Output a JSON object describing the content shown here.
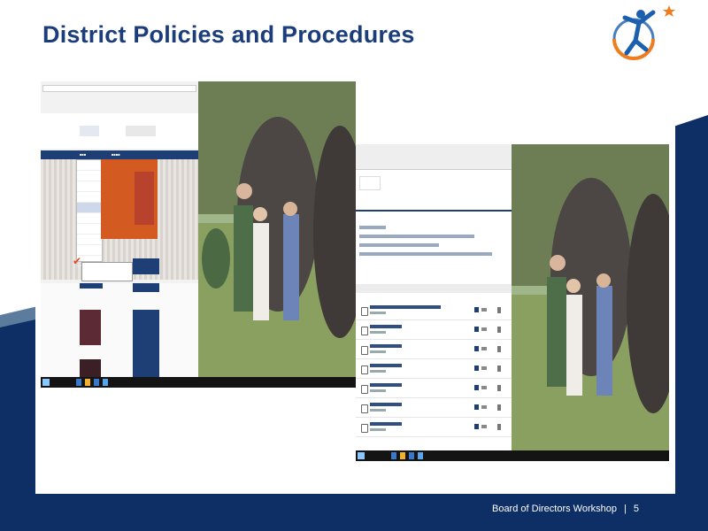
{
  "slide": {
    "title": "District Policies and Procedures",
    "footer_text": "Board of Directors Workshop",
    "footer_separator": "|",
    "page_number": "5"
  },
  "colors": {
    "title": "#1b3d7a",
    "navy_band": "#0d2f66",
    "steel_band": "#5c7c9e",
    "logo_orange": "#f07c20",
    "logo_blue": "#1b5fae",
    "site_nav": "#1d3f75",
    "site_orange": "#d35a21"
  },
  "icons": {
    "logo": "figure-with-star-logo",
    "screenshot1_photo": "people-with-elephants-photo",
    "screenshot2_photo": "people-with-elephants-photo"
  }
}
